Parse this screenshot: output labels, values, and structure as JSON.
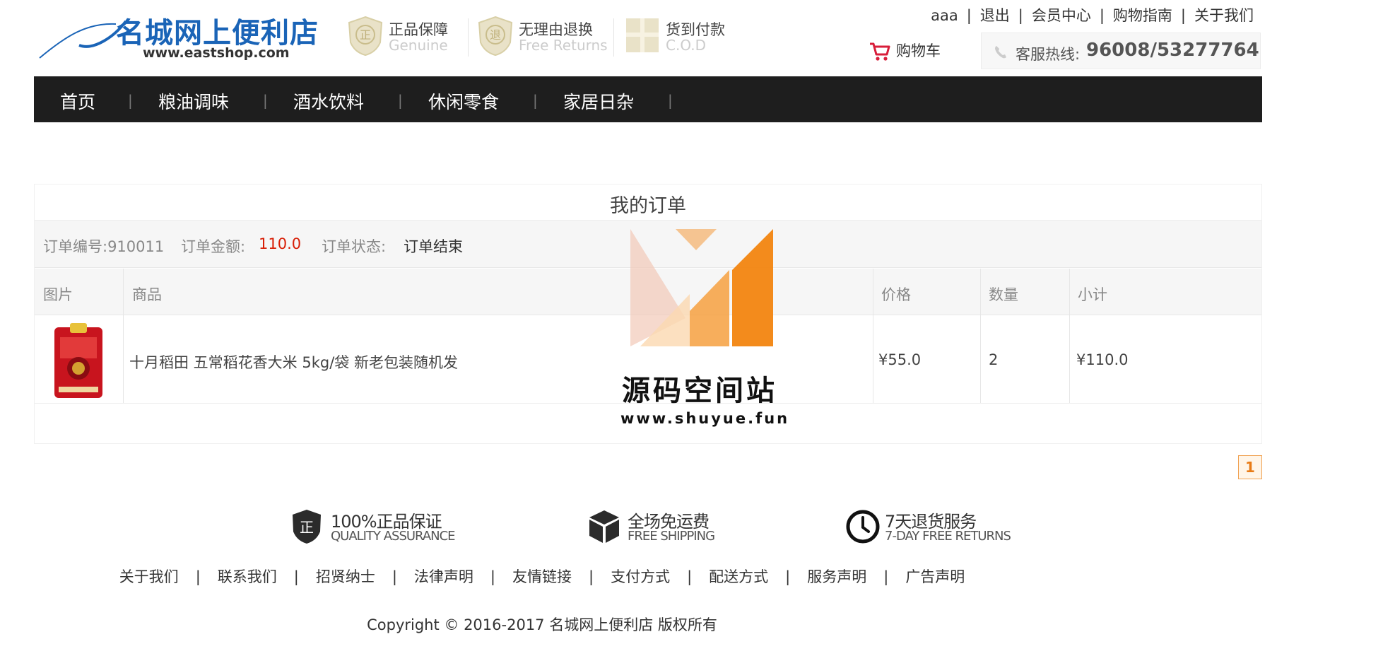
{
  "header": {
    "logo_title": "名城网上便利店",
    "logo_url": "www.eastshop.com",
    "guarantees": [
      {
        "cn": "正品保障",
        "en": "Genuine",
        "icon": "genuine-shield-icon"
      },
      {
        "cn": "无理由退换",
        "en": "Free Returns",
        "icon": "return-shield-icon"
      },
      {
        "cn": "货到付款",
        "en": "C.O.D",
        "icon": "gift-box-icon"
      }
    ],
    "top_links": [
      "aaa",
      "退出",
      "会员中心",
      "购物指南",
      "关于我们"
    ],
    "top_links_sep": "|",
    "cart_label": "购物车",
    "hotline_label": "客服热线:",
    "hotline_number": "96008/53277764"
  },
  "nav": {
    "items": [
      "首页",
      "粮油调味",
      "酒水饮料",
      "休闲零食",
      "家居日杂"
    ],
    "sep": "|"
  },
  "order": {
    "title": "我的订单",
    "number_label": "订单编号:910011",
    "amount_label": "订单金额:",
    "amount_value": "110.0",
    "status_label": "订单状态:",
    "status_value": "订单结束",
    "columns": [
      "图片",
      "商品",
      "价格",
      "数量",
      "小计"
    ],
    "items": [
      {
        "name": "十月稻田 五常稻花香大米 5kg/袋 新老包装随机发",
        "price": "¥55.0",
        "qty": "2",
        "subtotal": "¥110.0",
        "image": "rice-bag-image"
      }
    ]
  },
  "watermark": {
    "title": "源码空间站",
    "url": "www.shuyue.fun"
  },
  "pagination": {
    "current": "1"
  },
  "footer": {
    "services": [
      {
        "cn": "100%正品保证",
        "en": "QUALITY ASSURANCE",
        "icon": "quality-shield-icon"
      },
      {
        "cn": "全场免运费",
        "en": "FREE SHIPPING",
        "icon": "package-box-icon"
      },
      {
        "cn": "7天退货服务",
        "en": "7-DAY FREE RETURNS",
        "icon": "clock-icon"
      }
    ],
    "links": [
      "关于我们",
      "联系我们",
      "招贤纳士",
      "法律声明",
      "友情链接",
      "支付方式",
      "配送方式",
      "服务声明",
      "广告声明"
    ],
    "links_sep": "|",
    "copyright": "Copyright © 2016-2017 名城网上便利店 版权所有"
  },
  "colors": {
    "brand_blue": "#1a64b7",
    "nav_bg": "#1e1e1e",
    "price_red": "#d81e06",
    "page_orange": "#e87b16"
  }
}
